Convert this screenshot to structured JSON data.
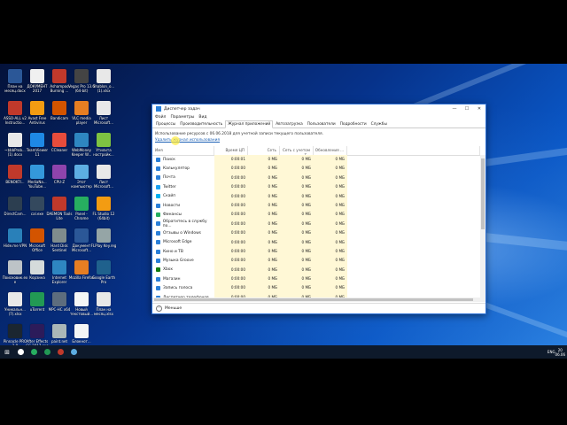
{
  "colors": {
    "accent": "#2a6fd6",
    "highlight_column": "#fff8d6"
  },
  "desktop_icons": [
    {
      "label": "План на месяц.docx",
      "icon": "word-doc-icon",
      "color": "#2b5797"
    },
    {
      "label": "ДОКУМЕНТ 2017",
      "icon": "document-icon",
      "color": "#f0f0f0"
    },
    {
      "label": "Ashampoo Burning ...",
      "icon": "ashampoo-icon",
      "color": "#c0392b"
    },
    {
      "label": "Vegas Pro 13.0 (64-bit)",
      "icon": "vegas-icon",
      "color": "#444444"
    },
    {
      "label": "Shablon_o... (1).xlsx",
      "icon": "excel-icon",
      "color": "#e8e8e8"
    },
    {
      "label": "ASSO-ALL v2 Instructio...",
      "icon": "pdf-icon",
      "color": "#c0392b"
    },
    {
      "label": "Avast Free Antivirus",
      "icon": "avast-icon",
      "color": "#f39c12"
    },
    {
      "label": "Bandicam",
      "icon": "bandicam-icon",
      "color": "#d35400"
    },
    {
      "label": "VLC media player",
      "icon": "vlc-icon",
      "color": "#e67e22"
    },
    {
      "label": "Лист Microsoft...",
      "icon": "excel-icon",
      "color": "#e8e8e8"
    },
    {
      "label": "~$bbProb... (1).docx",
      "icon": "word-doc-icon",
      "color": "#e8e8e8"
    },
    {
      "label": "TeamViewer 11",
      "icon": "teamviewer-icon",
      "color": "#1e88e5"
    },
    {
      "label": "CCleaner",
      "icon": "ccleaner-icon",
      "color": "#e74c3c"
    },
    {
      "label": "WebMoney Keeper W...",
      "icon": "webmoney-icon",
      "color": "#2e86c1"
    },
    {
      "label": "Утилита настройк...",
      "icon": "settings-utility-icon",
      "color": "#7dc242"
    },
    {
      "label": "BENOKTI...",
      "icon": "document-icon",
      "color": "#c0392b"
    },
    {
      "label": "MediaNa... YouTube...",
      "icon": "youtube-icon",
      "color": "#3498db"
    },
    {
      "label": "CPU-Z",
      "icon": "cpuz-icon",
      "color": "#8e44ad"
    },
    {
      "label": "Этот компьютер",
      "icon": "this-pc-icon",
      "color": "#5dade2"
    },
    {
      "label": "Лист Microsoft...",
      "icon": "excel-icon",
      "color": "#e8e8e8"
    },
    {
      "label": "DirectCam...",
      "icon": "camera-icon",
      "color": "#2c3e50"
    },
    {
      "label": "cal.exe",
      "icon": "calculator-icon",
      "color": "#34495e"
    },
    {
      "label": "DAEMON Tools Lite",
      "icon": "daemon-tools-icon",
      "color": "#c0392b"
    },
    {
      "label": "Panel - Chrome",
      "icon": "chrome-icon",
      "color": "#27ae60"
    },
    {
      "label": "FL Studio 12 (64bit)",
      "icon": "fl-studio-icon",
      "color": "#f39c12"
    },
    {
      "label": "Hide.me VPN",
      "icon": "vpn-icon",
      "color": "#2980b9"
    },
    {
      "label": "Microsoft Office",
      "icon": "office-icon",
      "color": "#d35400"
    },
    {
      "label": "Hard Disk Sentinel",
      "icon": "hdd-sentinel-icon",
      "color": "#7f8c8d"
    },
    {
      "label": "Документ Microsoft...",
      "icon": "word-doc-icon",
      "color": "#2b5797"
    },
    {
      "label": "FLPlay Key.reg",
      "icon": "registry-icon",
      "color": "#95a5a6"
    },
    {
      "label": "Поисковик.exe",
      "icon": "document-icon",
      "color": "#bdc3c7"
    },
    {
      "label": "Корзина",
      "icon": "recycle-bin-icon",
      "color": "#d5dbdb"
    },
    {
      "label": "Internet Explorer",
      "icon": "ie-icon",
      "color": "#2e86c1"
    },
    {
      "label": "Mozilla Firefox",
      "icon": "firefox-icon",
      "color": "#e67e22"
    },
    {
      "label": "Google Earth Pro",
      "icon": "google-earth-icon",
      "color": "#1f618d"
    },
    {
      "label": "Уникальн... (7).xlsx",
      "icon": "excel-icon",
      "color": "#e8e8e8"
    },
    {
      "label": "uTorrent",
      "icon": "utorrent-icon",
      "color": "#229954"
    },
    {
      "label": "MPC-HC x64",
      "icon": "mpc-icon",
      "color": "#5d6d7e"
    },
    {
      "label": "Новый текстовый...",
      "icon": "text-file-icon",
      "color": "#f4f6f6"
    },
    {
      "label": "План на месяц.xlsx",
      "icon": "excel-icon",
      "color": "#e8e8e8"
    },
    {
      "label": "Pinnacle PRO 2.0",
      "icon": "pinnacle-icon",
      "color": "#1b2631"
    },
    {
      "label": "After Effects CC 2017.exe",
      "icon": "after-effects-icon",
      "color": "#2c1b5a"
    },
    {
      "label": "paint.net",
      "icon": "paint-net-icon",
      "color": "#aab7b8"
    },
    {
      "label": "Блокнот...",
      "icon": "notepad-icon",
      "color": "#f4f6f6"
    }
  ],
  "task_manager": {
    "title": "Диспетчер задач",
    "window_buttons": {
      "minimize": "—",
      "maximize": "☐",
      "close": "✕"
    },
    "menu": [
      "Файл",
      "Параметры",
      "Вид"
    ],
    "tabs": [
      "Процессы",
      "Производительность",
      "Журнал приложений",
      "Автозагрузка",
      "Пользователи",
      "Подробности",
      "Службы"
    ],
    "active_tab": 2,
    "usage_text": "Использование ресурсов с 06.06.2018 для учетной записи текущего пользователя.",
    "delete_link": "Удалить журнал использования",
    "columns": [
      "Имя",
      "Время ЦП",
      "Сеть",
      "Сеть с учетом т...",
      "Обновления ..."
    ],
    "rows": [
      {
        "name": "Поиск",
        "cpu": "0:00:01",
        "net": "0 МБ",
        "metered": "0 МБ",
        "updates": "0 МБ",
        "color": "#2a7fd8"
      },
      {
        "name": "Калькулятор",
        "cpu": "0:00:00",
        "net": "0 МБ",
        "metered": "0 МБ",
        "updates": "0 МБ",
        "color": "#2a7fd8"
      },
      {
        "name": "Почта",
        "cpu": "0:00:00",
        "net": "0 МБ",
        "metered": "0 МБ",
        "updates": "0 МБ",
        "color": "#2a7fd8"
      },
      {
        "name": "Twitter",
        "cpu": "0:00:00",
        "net": "0 МБ",
        "metered": "0 МБ",
        "updates": "0 МБ",
        "color": "#1da1f2"
      },
      {
        "name": "Скайп",
        "cpu": "0:00:00",
        "net": "0 МБ",
        "metered": "0 МБ",
        "updates": "0 МБ",
        "color": "#00aff0"
      },
      {
        "name": "Новости",
        "cpu": "0:00:00",
        "net": "0 МБ",
        "metered": "0 МБ",
        "updates": "0 МБ",
        "color": "#2a7fd8"
      },
      {
        "name": "Финансы",
        "cpu": "0:00:00",
        "net": "0 МБ",
        "metered": "0 МБ",
        "updates": "0 МБ",
        "color": "#27ae60"
      },
      {
        "name": "Обратитесь в службу по...",
        "cpu": "0:00:00",
        "net": "0 МБ",
        "metered": "0 МБ",
        "updates": "0 МБ",
        "color": "#2a7fd8"
      },
      {
        "name": "Отзывы о Windows",
        "cpu": "0:00:00",
        "net": "0 МБ",
        "metered": "0 МБ",
        "updates": "0 МБ",
        "color": "#2a7fd8"
      },
      {
        "name": "Microsoft Edge",
        "cpu": "0:00:00",
        "net": "0 МБ",
        "metered": "0 МБ",
        "updates": "0 МБ",
        "color": "#2a7fd8"
      },
      {
        "name": "Кино и ТВ",
        "cpu": "0:00:00",
        "net": "0 МБ",
        "metered": "0 МБ",
        "updates": "0 МБ",
        "color": "#2a7fd8"
      },
      {
        "name": "Музыка Groove",
        "cpu": "0:00:00",
        "net": "0 МБ",
        "metered": "0 МБ",
        "updates": "0 МБ",
        "color": "#2a7fd8"
      },
      {
        "name": "Xbox",
        "cpu": "0:00:00",
        "net": "0 МБ",
        "metered": "0 МБ",
        "updates": "0 МБ",
        "color": "#107c10"
      },
      {
        "name": "Магазин",
        "cpu": "0:00:00",
        "net": "0 МБ",
        "metered": "0 МБ",
        "updates": "0 МБ",
        "color": "#2a7fd8"
      },
      {
        "name": "Запись голоса",
        "cpu": "0:00:00",
        "net": "0 МБ",
        "metered": "0 МБ",
        "updates": "0 МБ",
        "color": "#2a7fd8"
      },
      {
        "name": "Диспетчер телефонов",
        "cpu": "0:00:00",
        "net": "0 МБ",
        "metered": "0 МБ",
        "updates": "0 МБ",
        "color": "#2a7fd8"
      }
    ],
    "footer": "Меньше"
  },
  "taskbar": {
    "start": "⊞",
    "apps": [
      {
        "icon": "search-icon",
        "color": "#ffffff"
      },
      {
        "icon": "chrome-icon",
        "color": "#27ae60"
      },
      {
        "icon": "utorrent-icon",
        "color": "#229954"
      },
      {
        "icon": "bandicam-icon",
        "color": "#c0392b"
      },
      {
        "icon": "task-manager-icon",
        "color": "#5dade2"
      }
    ],
    "lang": "ENG",
    "time": "20",
    "date": "06.06"
  }
}
